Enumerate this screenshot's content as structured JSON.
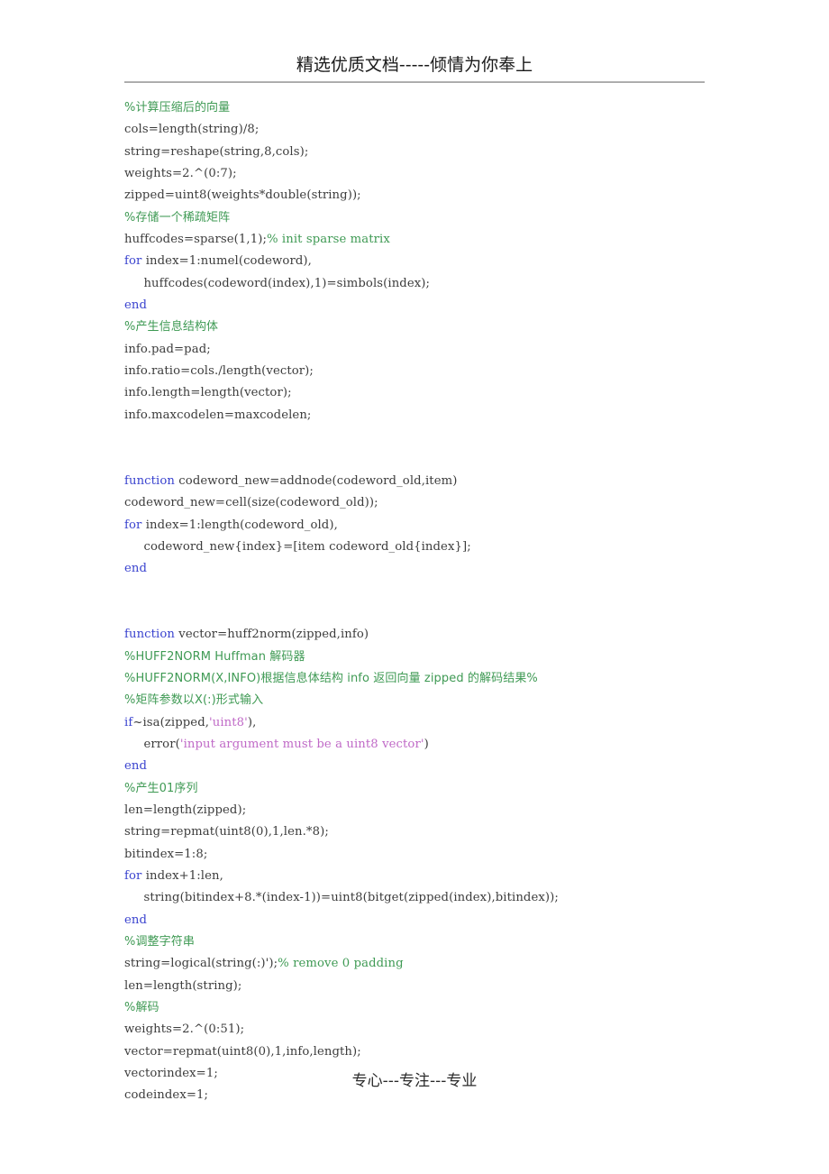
{
  "document": {
    "header": {
      "title": "精选优质文档-----倾情为你奉上"
    },
    "footer": {
      "text": "专心---专注---专业"
    },
    "colors": {
      "comment": "#3f9a54",
      "keyword": "#3a43cf",
      "string": "#c06ac7",
      "plain": "#3c3c3c",
      "rule": "#a8a8a8"
    },
    "code_lines": [
      {
        "id": 0,
        "type": "comment",
        "text": "%计算压缩后的向量"
      },
      {
        "id": 1,
        "type": "plain",
        "text": "cols=length(string)/8;"
      },
      {
        "id": 2,
        "type": "plain",
        "text": "string=reshape(string,8,cols);"
      },
      {
        "id": 3,
        "type": "plain",
        "text": "weights=2.^(0:7);"
      },
      {
        "id": 4,
        "type": "plain",
        "text": "zipped=uint8(weights*double(string));"
      },
      {
        "id": 5,
        "type": "comment",
        "text": "%存储一个稀疏矩阵"
      },
      {
        "id": 6,
        "type": "mixed",
        "segments": [
          {
            "style": "plain",
            "text": "huffcodes=sparse(1,1);"
          },
          {
            "style": "comment",
            "text": "% init sparse matrix"
          }
        ]
      },
      {
        "id": 7,
        "type": "mixed",
        "segments": [
          {
            "style": "kw",
            "text": "for"
          },
          {
            "style": "plain",
            "text": " index=1:numel(codeword),"
          }
        ]
      },
      {
        "id": 8,
        "type": "plain",
        "text": "     huffcodes(codeword(index),1)=simbols(index);"
      },
      {
        "id": 9,
        "type": "kw",
        "text": "end"
      },
      {
        "id": 10,
        "type": "comment",
        "text": "%产生信息结构体"
      },
      {
        "id": 11,
        "type": "plain",
        "text": "info.pad=pad;"
      },
      {
        "id": 12,
        "type": "plain",
        "text": "info.ratio=cols./length(vector);"
      },
      {
        "id": 13,
        "type": "plain",
        "text": "info.length=length(vector);"
      },
      {
        "id": 14,
        "type": "plain",
        "text": "info.maxcodelen=maxcodelen;"
      },
      {
        "id": 15,
        "type": "blank",
        "text": ""
      },
      {
        "id": 16,
        "type": "blank",
        "text": ""
      },
      {
        "id": 17,
        "type": "mixed",
        "segments": [
          {
            "style": "kw",
            "text": "function"
          },
          {
            "style": "plain",
            "text": " codeword_new=addnode(codeword_old,item)"
          }
        ]
      },
      {
        "id": 18,
        "type": "plain",
        "text": "codeword_new=cell(size(codeword_old));"
      },
      {
        "id": 19,
        "type": "mixed",
        "segments": [
          {
            "style": "kw",
            "text": "for"
          },
          {
            "style": "plain",
            "text": " index=1:length(codeword_old),"
          }
        ]
      },
      {
        "id": 20,
        "type": "plain",
        "text": "     codeword_new{index}=[item codeword_old{index}];"
      },
      {
        "id": 21,
        "type": "kw",
        "text": "end"
      },
      {
        "id": 22,
        "type": "blank",
        "text": ""
      },
      {
        "id": 23,
        "type": "blank",
        "text": ""
      },
      {
        "id": 24,
        "type": "mixed",
        "segments": [
          {
            "style": "kw",
            "text": "function"
          },
          {
            "style": "plain",
            "text": " vector=huff2norm(zipped,info)"
          }
        ]
      },
      {
        "id": 25,
        "type": "comment",
        "text": "%HUFF2NORM Huffman 解码器"
      },
      {
        "id": 26,
        "type": "comment",
        "text": "%HUFF2NORM(X,INFO)根据信息体结构 info 返回向量 zipped 的解码结果%"
      },
      {
        "id": 27,
        "type": "comment",
        "text": "%矩阵参数以X(:)形式输入"
      },
      {
        "id": 28,
        "type": "mixed",
        "segments": [
          {
            "style": "kw",
            "text": "if"
          },
          {
            "style": "plain",
            "text": "~isa(zipped,"
          },
          {
            "style": "str",
            "text": "'uint8'"
          },
          {
            "style": "plain",
            "text": "),"
          }
        ]
      },
      {
        "id": 29,
        "type": "mixed",
        "segments": [
          {
            "style": "plain",
            "text": "     error("
          },
          {
            "style": "str",
            "text": "'input argument must be a uint8 vector'"
          },
          {
            "style": "plain",
            "text": ")"
          }
        ]
      },
      {
        "id": 30,
        "type": "kw",
        "text": "end"
      },
      {
        "id": 31,
        "type": "comment",
        "text": "%产生01序列"
      },
      {
        "id": 32,
        "type": "plain",
        "text": "len=length(zipped);"
      },
      {
        "id": 33,
        "type": "plain",
        "text": "string=repmat(uint8(0),1,len.*8);"
      },
      {
        "id": 34,
        "type": "plain",
        "text": "bitindex=1:8;"
      },
      {
        "id": 35,
        "type": "mixed",
        "segments": [
          {
            "style": "kw",
            "text": "for"
          },
          {
            "style": "plain",
            "text": " index+1:len,"
          }
        ]
      },
      {
        "id": 36,
        "type": "plain",
        "text": "     string(bitindex+8.*(index-1))=uint8(bitget(zipped(index),bitindex));"
      },
      {
        "id": 37,
        "type": "kw",
        "text": "end"
      },
      {
        "id": 38,
        "type": "comment",
        "text": "%调整字符串"
      },
      {
        "id": 39,
        "type": "mixed",
        "segments": [
          {
            "style": "plain",
            "text": "string=logical(string(:)');"
          },
          {
            "style": "comment",
            "text": "% remove 0 padding"
          }
        ]
      },
      {
        "id": 40,
        "type": "plain",
        "text": "len=length(string);"
      },
      {
        "id": 41,
        "type": "comment",
        "text": "%解码"
      },
      {
        "id": 42,
        "type": "plain",
        "text": "weights=2.^(0:51);"
      },
      {
        "id": 43,
        "type": "plain",
        "text": "vector=repmat(uint8(0),1,info,length);"
      },
      {
        "id": 44,
        "type": "plain",
        "text": "vectorindex=1;"
      },
      {
        "id": 45,
        "type": "plain",
        "text": "codeindex=1;"
      }
    ]
  }
}
